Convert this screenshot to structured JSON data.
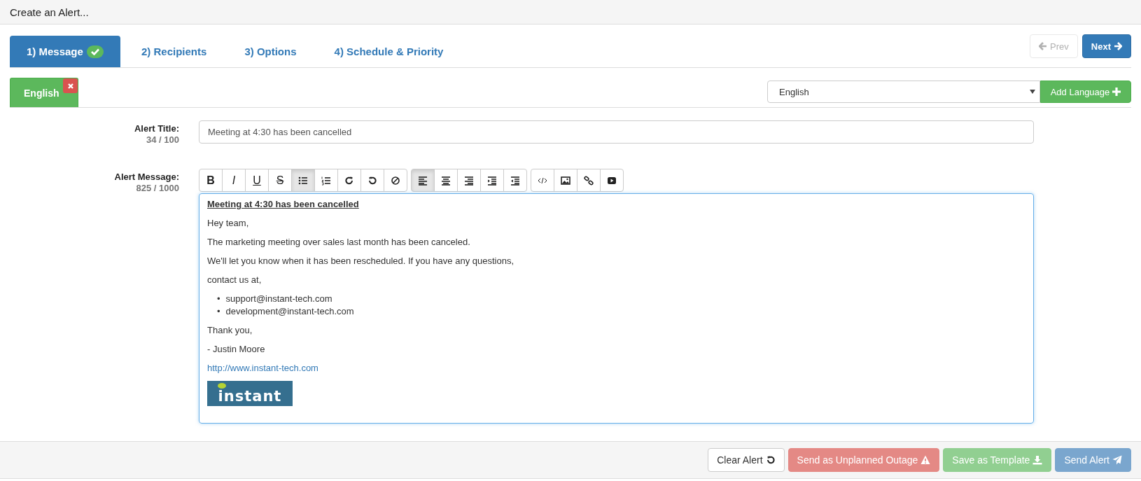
{
  "header": {
    "title": "Create an Alert..."
  },
  "tabs": [
    {
      "label": "1) Message",
      "selected": true,
      "complete": true
    },
    {
      "label": "2) Recipients",
      "selected": false,
      "complete": false
    },
    {
      "label": "3) Options",
      "selected": false,
      "complete": false
    },
    {
      "label": "4) Schedule & Priority",
      "selected": false,
      "complete": false
    }
  ],
  "nav": {
    "prev": {
      "label": "Prev",
      "disabled": true
    },
    "next": {
      "label": "Next",
      "disabled": false
    }
  },
  "languages": [
    {
      "label": "English",
      "selected": true
    }
  ],
  "language_select": {
    "value": "English"
  },
  "add_language": {
    "label": "Add Language"
  },
  "title_field": {
    "label": "Alert Title:",
    "count": "34 / 100",
    "value": "Meeting at 4:30 has been cancelled"
  },
  "message_field": {
    "label": "Alert Message:",
    "count": "825 / 1000"
  },
  "toolbar": [
    [
      {
        "kind": "bold",
        "label": "B",
        "selected": false
      },
      {
        "kind": "italic",
        "label": "I",
        "selected": false
      },
      {
        "kind": "underline",
        "label": "U",
        "selected": false
      },
      {
        "kind": "strike",
        "label": "S",
        "selected": false
      },
      {
        "kind": "ul",
        "selected": true
      },
      {
        "kind": "ol",
        "selected": false
      },
      {
        "kind": "redo",
        "selected": false
      },
      {
        "kind": "undo",
        "selected": false
      },
      {
        "kind": "clear",
        "selected": false
      }
    ],
    [
      {
        "kind": "left",
        "selected": true
      },
      {
        "kind": "center",
        "selected": false
      },
      {
        "kind": "right",
        "selected": false
      },
      {
        "kind": "indent",
        "selected": false
      },
      {
        "kind": "outdent",
        "selected": false
      }
    ],
    [
      {
        "kind": "code",
        "selected": false
      },
      {
        "kind": "image",
        "selected": false
      },
      {
        "kind": "link",
        "selected": false
      },
      {
        "kind": "video",
        "selected": false
      }
    ]
  ],
  "message": [
    {
      "kind": "heading",
      "text": "Meeting at 4:30 has been cancelled"
    },
    {
      "kind": "para",
      "text": "Hey team,"
    },
    {
      "kind": "para",
      "text": "The marketing meeting over sales last month has been canceled."
    },
    {
      "kind": "para",
      "text": "We'll let you know when it has been rescheduled. If you have any questions,"
    },
    {
      "kind": "para",
      "text": "contact us at,"
    },
    {
      "kind": "list",
      "items": [
        {
          "marker": "•",
          "text": "support@instant-tech.com"
        },
        {
          "marker": "•",
          "text": "development@instant-tech.com"
        }
      ]
    },
    {
      "kind": "para",
      "text": "Thank you,"
    },
    {
      "kind": "para",
      "text": "- Justin Moore"
    },
    {
      "kind": "link",
      "text": "http://www.instant-tech.com"
    },
    {
      "kind": "logo",
      "text": "instant"
    }
  ],
  "footer_buttons": [
    {
      "label": "Clear Alert",
      "kind": "clear",
      "disabled": false
    },
    {
      "label": "Send as Unplanned Outage",
      "kind": "outage",
      "disabled": true
    },
    {
      "label": "Save as Template",
      "kind": "template",
      "disabled": true
    },
    {
      "label": "Send Alert",
      "kind": "send",
      "disabled": true
    }
  ]
}
